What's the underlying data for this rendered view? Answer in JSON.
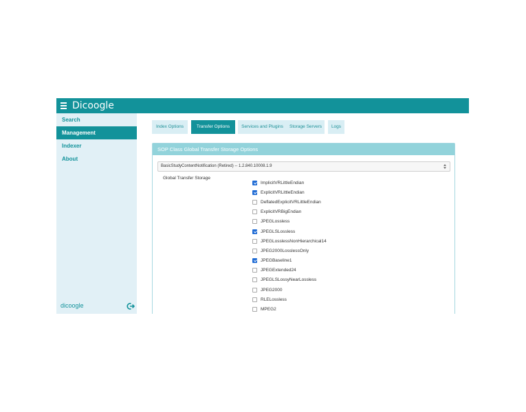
{
  "app": {
    "title": "Dicoogle"
  },
  "sidebar": {
    "items": [
      {
        "label": "Search",
        "active": false
      },
      {
        "label": "Management",
        "active": true
      },
      {
        "label": "Indexer",
        "active": false
      },
      {
        "label": "About",
        "active": false
      }
    ],
    "footer_logo": "dicoogle"
  },
  "tabs": [
    {
      "label": "Index Options",
      "active": false
    },
    {
      "label": "Transfer Options",
      "active": true
    },
    {
      "label": "Services and Plugins",
      "active": false
    },
    {
      "label": "Storage Servers",
      "active": false
    },
    {
      "label": "Logs",
      "active": false
    }
  ],
  "panel": {
    "title": "SOP Class Global Transfer Storage Options",
    "select_value": "BasicStudyContentNotification (Retired) -- 1.2.840.10008.1.9",
    "field_label": "Global Transfer Storage",
    "options": [
      {
        "label": "ImplicitVRLittleEndian",
        "checked": true
      },
      {
        "label": "ExplicitVRLittleEndian",
        "checked": true
      },
      {
        "label": "DeflatedExplicitVRLittleEndian",
        "checked": false
      },
      {
        "label": "ExplicitVRBigEndian",
        "checked": false
      },
      {
        "label": "JPEGLossless",
        "checked": false
      },
      {
        "label": "JPEGLSLossless",
        "checked": true
      },
      {
        "label": "JPEGLosslessNonHierarchical14",
        "checked": false
      },
      {
        "label": "JPEG2000LosslessOnly",
        "checked": false
      },
      {
        "label": "JPEGBaseline1",
        "checked": true
      },
      {
        "label": "JPEGExtended24",
        "checked": false
      },
      {
        "label": "JPEGLSLossyNearLossless",
        "checked": false
      },
      {
        "label": "JPEG2000",
        "checked": false
      },
      {
        "label": "RLELossless",
        "checked": false
      },
      {
        "label": "MPEG2",
        "checked": false
      }
    ]
  },
  "colors": {
    "accent": "#12929a",
    "sidebar_bg": "#e1f0f6",
    "panel_header": "#92d3db",
    "checkbox_checked": "#1f6bd4"
  }
}
